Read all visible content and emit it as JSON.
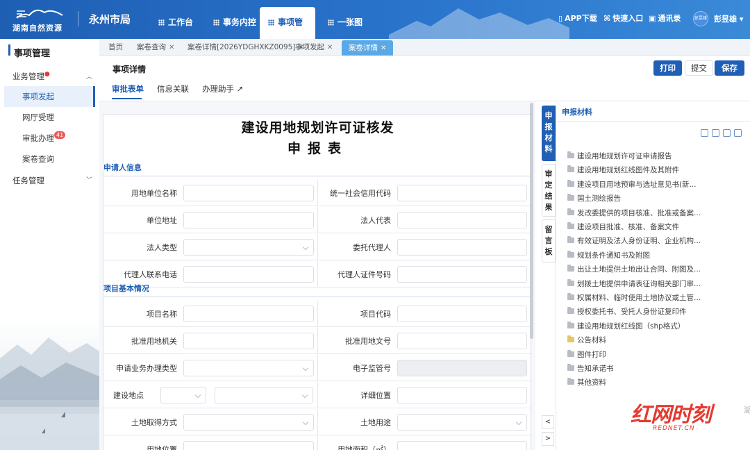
{
  "app": {
    "logo_text": "湖南自然资源",
    "bureau": "永州市局",
    "main_tabs": [
      "工作台",
      "事务内控",
      "事项管理",
      "一张图"
    ],
    "active_tab": "事项管理",
    "actions": {
      "app_download": "APP下载",
      "quick_entry": "快速入口",
      "contacts": "通讯录"
    },
    "avatar_text": "彭昱雄",
    "user_name": "彭昱雄",
    "colors": {
      "brand": "#1f5fb5",
      "tab_active_bg": "#5aa9e6",
      "badge": "#f05b55"
    }
  },
  "sidebar": {
    "title": "事项管理",
    "groups": {
      "business": "业务管理",
      "tasks": "任务管理"
    },
    "items": [
      {
        "label": "事项发起",
        "active": true
      },
      {
        "label": "网厅受理"
      },
      {
        "label": "审批办理",
        "badge": "41"
      },
      {
        "label": "案卷查询"
      }
    ]
  },
  "breadcrumbs": [
    {
      "label": "首页"
    },
    {
      "label": "案卷查询"
    },
    {
      "label": "案卷详情[2026YDGHXKZ0095]"
    },
    {
      "label": "事项发起"
    },
    {
      "label": "案卷详情",
      "active": true
    }
  ],
  "page": {
    "title": "事项详情",
    "buttons": {
      "print": "打印",
      "submit": "提交",
      "save": "保存"
    },
    "sub_tabs": [
      "审批表单",
      "信息关联",
      "办理助手"
    ]
  },
  "form": {
    "title1": "建设用地规划许可证核发",
    "title2": "申报表",
    "sections": {
      "applicant": "申请人信息",
      "project": "项目基本情况"
    },
    "applicant_rows": [
      {
        "l": "用地单位名称",
        "r": "统一社会信用代码"
      },
      {
        "l": "单位地址",
        "r": "法人代表"
      },
      {
        "l": "法人类型",
        "r": "委托代理人",
        "l_select": true
      },
      {
        "l": "代理人联系电话",
        "r": "代理人证件号码"
      }
    ],
    "project_rows": [
      {
        "l": "项目名称",
        "r": "项目代码"
      },
      {
        "l": "批准用地机关",
        "r": "批准用地文号"
      },
      {
        "l": "申请业务办理类型",
        "r": "电子监管号",
        "l_select": true,
        "r_disabled": true
      },
      {
        "l": "建设地点",
        "r": "详细位置",
        "l_double_select": true
      },
      {
        "l": "土地取得方式",
        "r": "土地用途",
        "l_select": true,
        "r_select": true
      },
      {
        "l": "用地位置",
        "r": "用地面积（㎡）"
      }
    ]
  },
  "vtabs": [
    "申报材料",
    "审定结果",
    "留言板"
  ],
  "nav": {
    "prev": "<",
    "next": ">"
  },
  "materials": {
    "title": "申报材料",
    "items": [
      "建设用地规划许可证申请报告",
      "建设用地规划红线图件及其附件",
      "建设项目用地预审与选址意见书(新...",
      "国土测绘报告",
      "发改委提供的项目核准、批准或备案...",
      "建设项目批准、核准、备案文件",
      "有效证明及法人身份证明、企业机构...",
      "规划条件通知书及附图",
      "出让土地提供土地出让合同、附图及...",
      "划拨土地提供申请表征询相关部门审...",
      "权属材料、临时使用土地协议或土管...",
      "授权委托书、受托人身份证复印件",
      "建设用地规划红线图（shp格式）",
      "公告材料",
      "图件打印",
      "告知承诺书",
      "其他资料"
    ],
    "open_item": "公告材料"
  },
  "watermark": {
    "logo": "红网时刻",
    "sub": "REDNET.CN",
    "edge": "湖"
  }
}
